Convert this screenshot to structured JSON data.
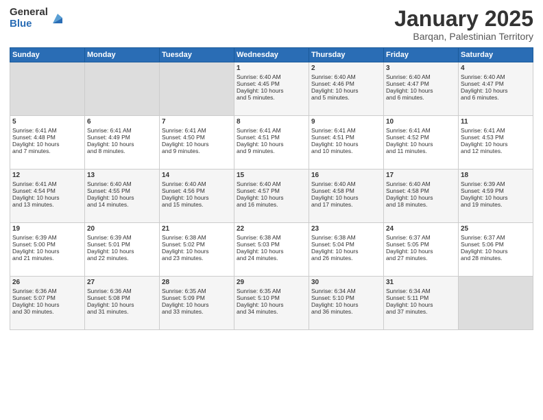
{
  "logo": {
    "general": "General",
    "blue": "Blue"
  },
  "header": {
    "month": "January 2025",
    "location": "Barqan, Palestinian Territory"
  },
  "days_of_week": [
    "Sunday",
    "Monday",
    "Tuesday",
    "Wednesday",
    "Thursday",
    "Friday",
    "Saturday"
  ],
  "weeks": [
    [
      {
        "day": "",
        "content": ""
      },
      {
        "day": "",
        "content": ""
      },
      {
        "day": "",
        "content": ""
      },
      {
        "day": "1",
        "content": "Sunrise: 6:40 AM\nSunset: 4:45 PM\nDaylight: 10 hours\nand 5 minutes."
      },
      {
        "day": "2",
        "content": "Sunrise: 6:40 AM\nSunset: 4:46 PM\nDaylight: 10 hours\nand 5 minutes."
      },
      {
        "day": "3",
        "content": "Sunrise: 6:40 AM\nSunset: 4:47 PM\nDaylight: 10 hours\nand 6 minutes."
      },
      {
        "day": "4",
        "content": "Sunrise: 6:40 AM\nSunset: 4:47 PM\nDaylight: 10 hours\nand 6 minutes."
      }
    ],
    [
      {
        "day": "5",
        "content": "Sunrise: 6:41 AM\nSunset: 4:48 PM\nDaylight: 10 hours\nand 7 minutes."
      },
      {
        "day": "6",
        "content": "Sunrise: 6:41 AM\nSunset: 4:49 PM\nDaylight: 10 hours\nand 8 minutes."
      },
      {
        "day": "7",
        "content": "Sunrise: 6:41 AM\nSunset: 4:50 PM\nDaylight: 10 hours\nand 9 minutes."
      },
      {
        "day": "8",
        "content": "Sunrise: 6:41 AM\nSunset: 4:51 PM\nDaylight: 10 hours\nand 9 minutes."
      },
      {
        "day": "9",
        "content": "Sunrise: 6:41 AM\nSunset: 4:51 PM\nDaylight: 10 hours\nand 10 minutes."
      },
      {
        "day": "10",
        "content": "Sunrise: 6:41 AM\nSunset: 4:52 PM\nDaylight: 10 hours\nand 11 minutes."
      },
      {
        "day": "11",
        "content": "Sunrise: 6:41 AM\nSunset: 4:53 PM\nDaylight: 10 hours\nand 12 minutes."
      }
    ],
    [
      {
        "day": "12",
        "content": "Sunrise: 6:41 AM\nSunset: 4:54 PM\nDaylight: 10 hours\nand 13 minutes."
      },
      {
        "day": "13",
        "content": "Sunrise: 6:40 AM\nSunset: 4:55 PM\nDaylight: 10 hours\nand 14 minutes."
      },
      {
        "day": "14",
        "content": "Sunrise: 6:40 AM\nSunset: 4:56 PM\nDaylight: 10 hours\nand 15 minutes."
      },
      {
        "day": "15",
        "content": "Sunrise: 6:40 AM\nSunset: 4:57 PM\nDaylight: 10 hours\nand 16 minutes."
      },
      {
        "day": "16",
        "content": "Sunrise: 6:40 AM\nSunset: 4:58 PM\nDaylight: 10 hours\nand 17 minutes."
      },
      {
        "day": "17",
        "content": "Sunrise: 6:40 AM\nSunset: 4:58 PM\nDaylight: 10 hours\nand 18 minutes."
      },
      {
        "day": "18",
        "content": "Sunrise: 6:39 AM\nSunset: 4:59 PM\nDaylight: 10 hours\nand 19 minutes."
      }
    ],
    [
      {
        "day": "19",
        "content": "Sunrise: 6:39 AM\nSunset: 5:00 PM\nDaylight: 10 hours\nand 21 minutes."
      },
      {
        "day": "20",
        "content": "Sunrise: 6:39 AM\nSunset: 5:01 PM\nDaylight: 10 hours\nand 22 minutes."
      },
      {
        "day": "21",
        "content": "Sunrise: 6:38 AM\nSunset: 5:02 PM\nDaylight: 10 hours\nand 23 minutes."
      },
      {
        "day": "22",
        "content": "Sunrise: 6:38 AM\nSunset: 5:03 PM\nDaylight: 10 hours\nand 24 minutes."
      },
      {
        "day": "23",
        "content": "Sunrise: 6:38 AM\nSunset: 5:04 PM\nDaylight: 10 hours\nand 26 minutes."
      },
      {
        "day": "24",
        "content": "Sunrise: 6:37 AM\nSunset: 5:05 PM\nDaylight: 10 hours\nand 27 minutes."
      },
      {
        "day": "25",
        "content": "Sunrise: 6:37 AM\nSunset: 5:06 PM\nDaylight: 10 hours\nand 28 minutes."
      }
    ],
    [
      {
        "day": "26",
        "content": "Sunrise: 6:36 AM\nSunset: 5:07 PM\nDaylight: 10 hours\nand 30 minutes."
      },
      {
        "day": "27",
        "content": "Sunrise: 6:36 AM\nSunset: 5:08 PM\nDaylight: 10 hours\nand 31 minutes."
      },
      {
        "day": "28",
        "content": "Sunrise: 6:35 AM\nSunset: 5:09 PM\nDaylight: 10 hours\nand 33 minutes."
      },
      {
        "day": "29",
        "content": "Sunrise: 6:35 AM\nSunset: 5:10 PM\nDaylight: 10 hours\nand 34 minutes."
      },
      {
        "day": "30",
        "content": "Sunrise: 6:34 AM\nSunset: 5:10 PM\nDaylight: 10 hours\nand 36 minutes."
      },
      {
        "day": "31",
        "content": "Sunrise: 6:34 AM\nSunset: 5:11 PM\nDaylight: 10 hours\nand 37 minutes."
      },
      {
        "day": "",
        "content": ""
      }
    ]
  ]
}
